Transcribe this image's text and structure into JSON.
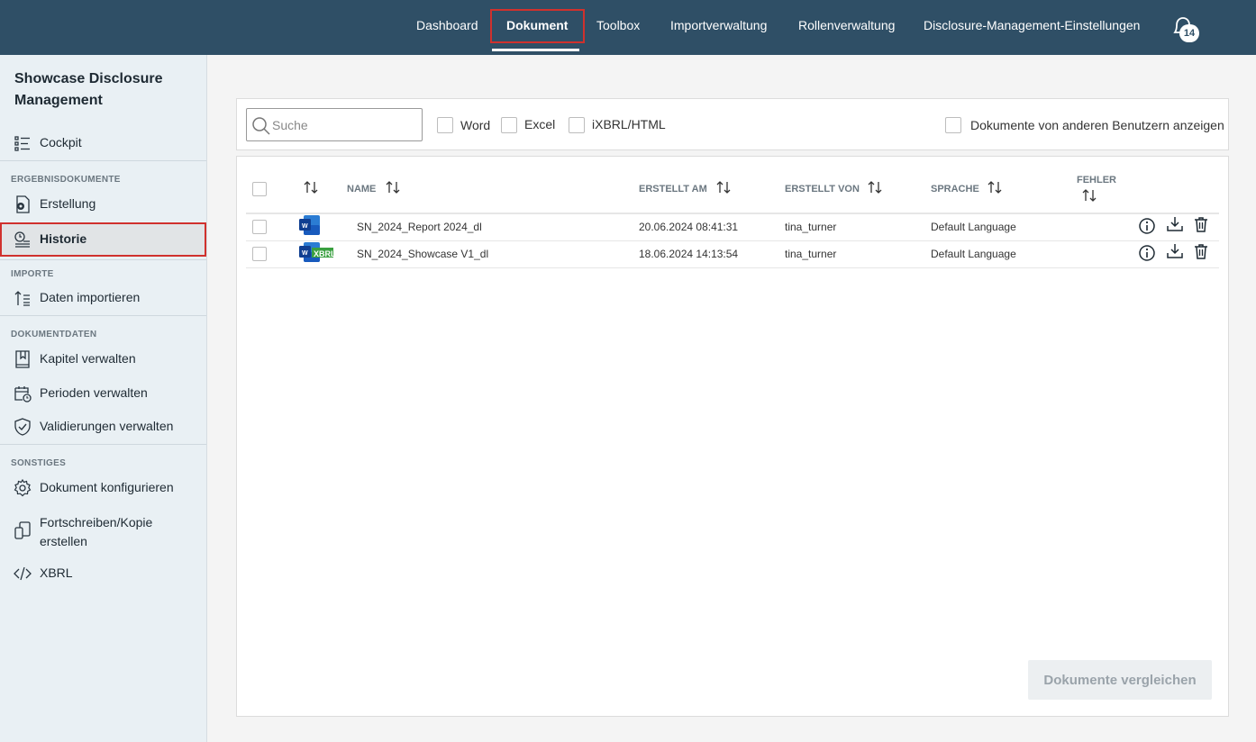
{
  "nav": {
    "items": [
      {
        "label": "Dashboard"
      },
      {
        "label": "Dokument"
      },
      {
        "label": "Toolbox"
      },
      {
        "label": "Importverwaltung"
      },
      {
        "label": "Rollenverwaltung"
      },
      {
        "label": "Disclosure-Management-Einstellungen"
      }
    ],
    "active": "Dokument",
    "notification_count": "14"
  },
  "sidebar": {
    "title": "Showcase Disclosure Management",
    "cockpit": "Cockpit",
    "sections": {
      "ergebnis": "ERGEBNISDOKUMENTE",
      "importe": "IMPORTE",
      "dokumentdaten": "DOKUMENTDATEN",
      "sonstiges": "SONSTIGES"
    },
    "items": {
      "erstellung": "Erstellung",
      "historie": "Historie",
      "daten_importieren": "Daten importieren",
      "kapitel": "Kapitel verwalten",
      "perioden": "Perioden verwalten",
      "validierungen": "Validierungen verwalten",
      "konfigurieren": "Dokument konfigurieren",
      "fortschreiben_1": "Fortschreiben/Kopie",
      "fortschreiben_2": "erstellen",
      "xbrl": "XBRL"
    },
    "active": "Historie"
  },
  "filters": {
    "search_placeholder": "Suche",
    "word": "Word",
    "excel": "Excel",
    "ixbrl": "iXBRL/HTML",
    "others": "Dokumente von anderen Benutzern anzeigen"
  },
  "table": {
    "headers": {
      "name": "NAME",
      "erstellt_am": "ERSTELLT AM",
      "erstellt_von": "ERSTELLT VON",
      "sprache": "SPRACHE",
      "fehler": "FEHLER"
    },
    "rows": [
      {
        "name": "SN_2024_Report 2024_dl",
        "date": "20.06.2024 08:41:31",
        "user": "tina_turner",
        "language": "Default Language",
        "type": "word"
      },
      {
        "name": "SN_2024_Showcase V1_dl",
        "date": "18.06.2024 14:13:54",
        "user": "tina_turner",
        "language": "Default Language",
        "type": "word-xbrl",
        "badge": "XBRL"
      }
    ]
  },
  "compare_button": "Dokumente vergleichen",
  "colors": {
    "topbar": "#2f4f66",
    "sidebar": "#e9f0f4",
    "highlight": "#d0312d",
    "word_blue": "#185abd"
  }
}
